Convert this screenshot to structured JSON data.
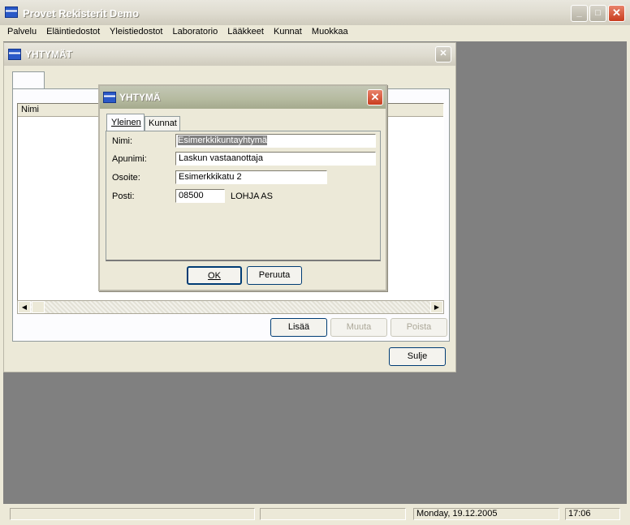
{
  "app": {
    "title": "Provet Rekisterit Demo",
    "menu": [
      "Palvelu",
      "Eläintiedostot",
      "Yleistiedostot",
      "Laboratorio",
      "Lääkkeet",
      "Kunnat",
      "Muokkaa"
    ]
  },
  "list_window": {
    "title": "YHTYMÄT",
    "column_header": "Nimi",
    "buttons": {
      "add": "Lisää",
      "edit": "Muuta",
      "delete": "Poista",
      "close": "Sulje"
    }
  },
  "dialog": {
    "title": "YHTYMÄ",
    "tabs": [
      "Yleinen",
      "Kunnat"
    ],
    "fields": {
      "nimi_label": "Nimi:",
      "nimi_value": "Esimerkkikuntayhtymä",
      "apunimi_label": "Apunimi:",
      "apunimi_value": "Laskun vastaanottaja",
      "osoite_label": "Osoite:",
      "osoite_value": "Esimerkkikatu 2",
      "posti_label": "Posti:",
      "posti_value": "08500",
      "posti_city": "LOHJA AS"
    },
    "ok": "OK",
    "cancel": "Peruuta"
  },
  "statusbar": {
    "date": "Monday, 19.12.2005",
    "time": "17:06"
  },
  "colors": {
    "xp_close": "#c93c1e",
    "selection": "#808080",
    "face": "#ece9d8"
  }
}
